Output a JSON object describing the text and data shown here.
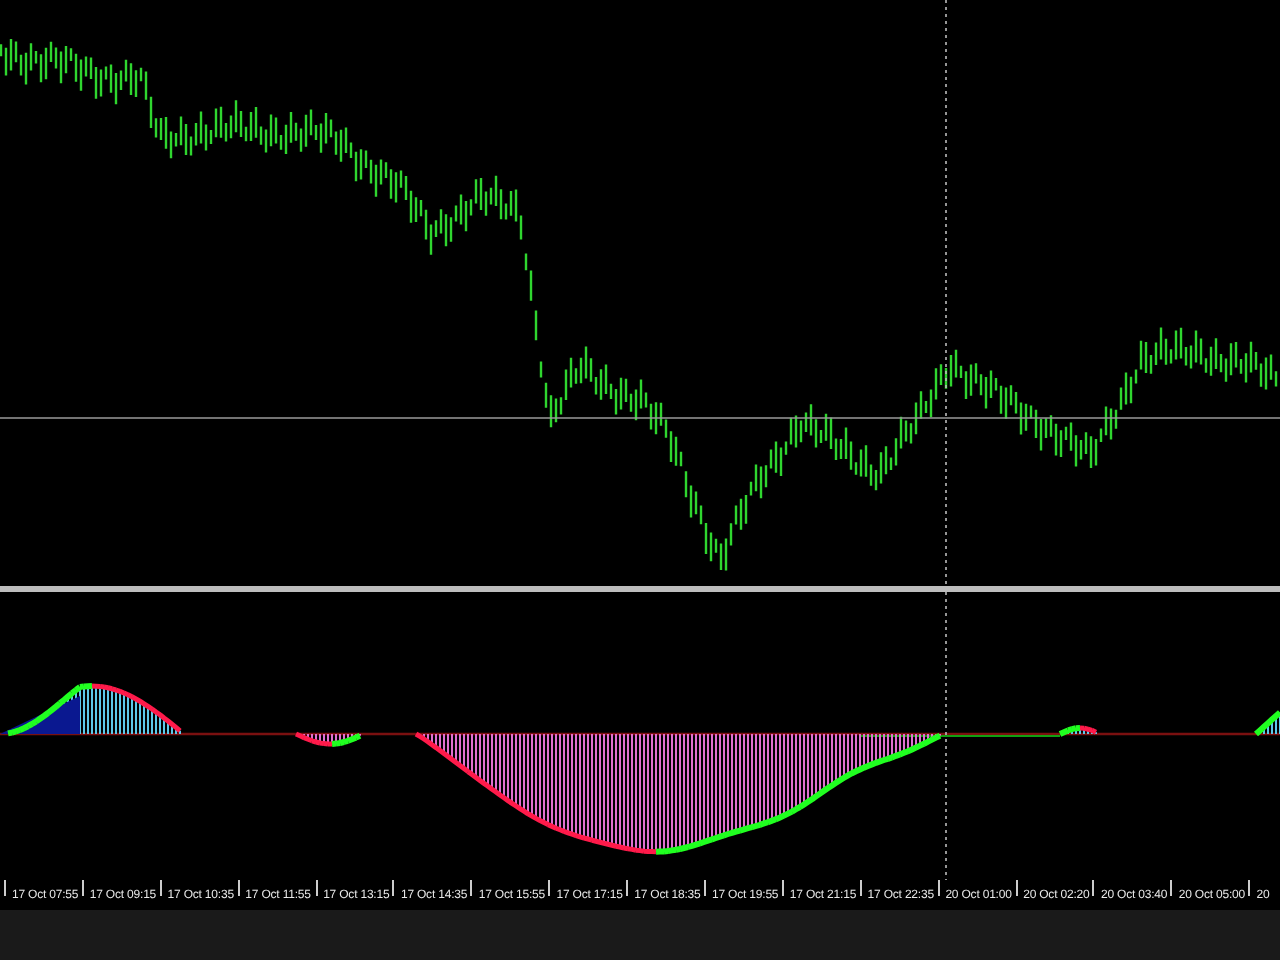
{
  "time_axis": {
    "labels": [
      "17 Oct 07:55",
      "17 Oct 09:15",
      "17 Oct 10:35",
      "17 Oct 11:55",
      "17 Oct 13:15",
      "17 Oct 14:35",
      "17 Oct 15:55",
      "17 Oct 17:15",
      "17 Oct 18:35",
      "17 Oct 19:55",
      "17 Oct 21:15",
      "17 Oct 22:35",
      "20 Oct 01:00",
      "20 Oct 02:20",
      "20 Oct 03:40",
      "20 Oct 05:00",
      "20"
    ]
  }
}
